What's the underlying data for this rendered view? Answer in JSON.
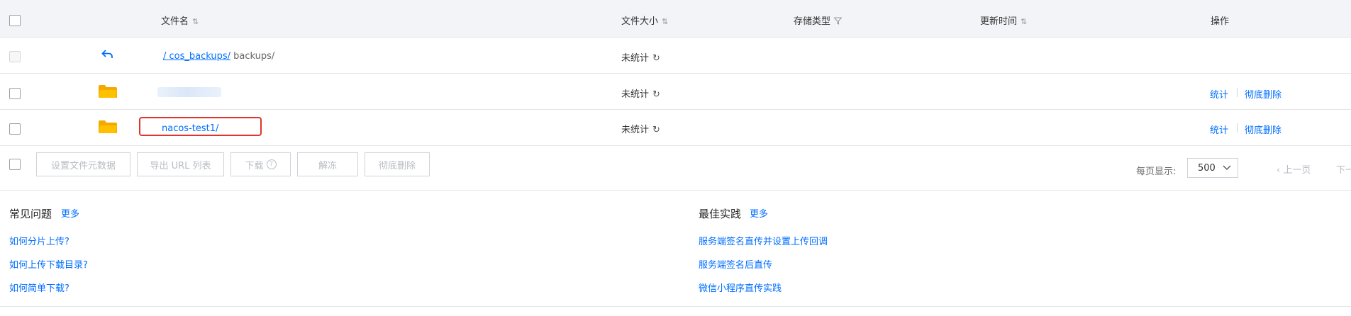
{
  "table": {
    "headers": {
      "name": "文件名",
      "size": "文件大小",
      "storage": "存储类型",
      "updated": "更新时间",
      "actions": "操作"
    },
    "back_row": {
      "path_link": "/ cos_backups/",
      "path_rest": "backups/",
      "size": "未统计"
    },
    "rows": [
      {
        "name": "",
        "size": "未统计",
        "actions": [
          "统计",
          "彻底删除"
        ]
      },
      {
        "name": "nacos-test1/",
        "size": "未统计",
        "actions": [
          "统计",
          "彻底删除"
        ]
      }
    ],
    "highlight_color": "#e0352b"
  },
  "toolbar": {
    "buttons": [
      "设置文件元数据",
      "导出 URL 列表",
      "下载",
      "解冻",
      "彻底删除"
    ]
  },
  "pagination": {
    "per_page_label": "每页显示:",
    "per_page_value": "500",
    "prev_label": "上一页",
    "next_label": "下一"
  },
  "faq": {
    "title": "常见问题",
    "more": "更多",
    "links": [
      "如何分片上传?",
      "如何上传下载目录?",
      "如何简单下载?"
    ]
  },
  "best_practice": {
    "title": "最佳实践",
    "more": "更多",
    "links": [
      "服务端签名直传并设置上传回调",
      "服务端签名后直传",
      "微信小程序直传实践"
    ]
  },
  "colors": {
    "accent": "#006eff",
    "folder": "#ffc000"
  }
}
